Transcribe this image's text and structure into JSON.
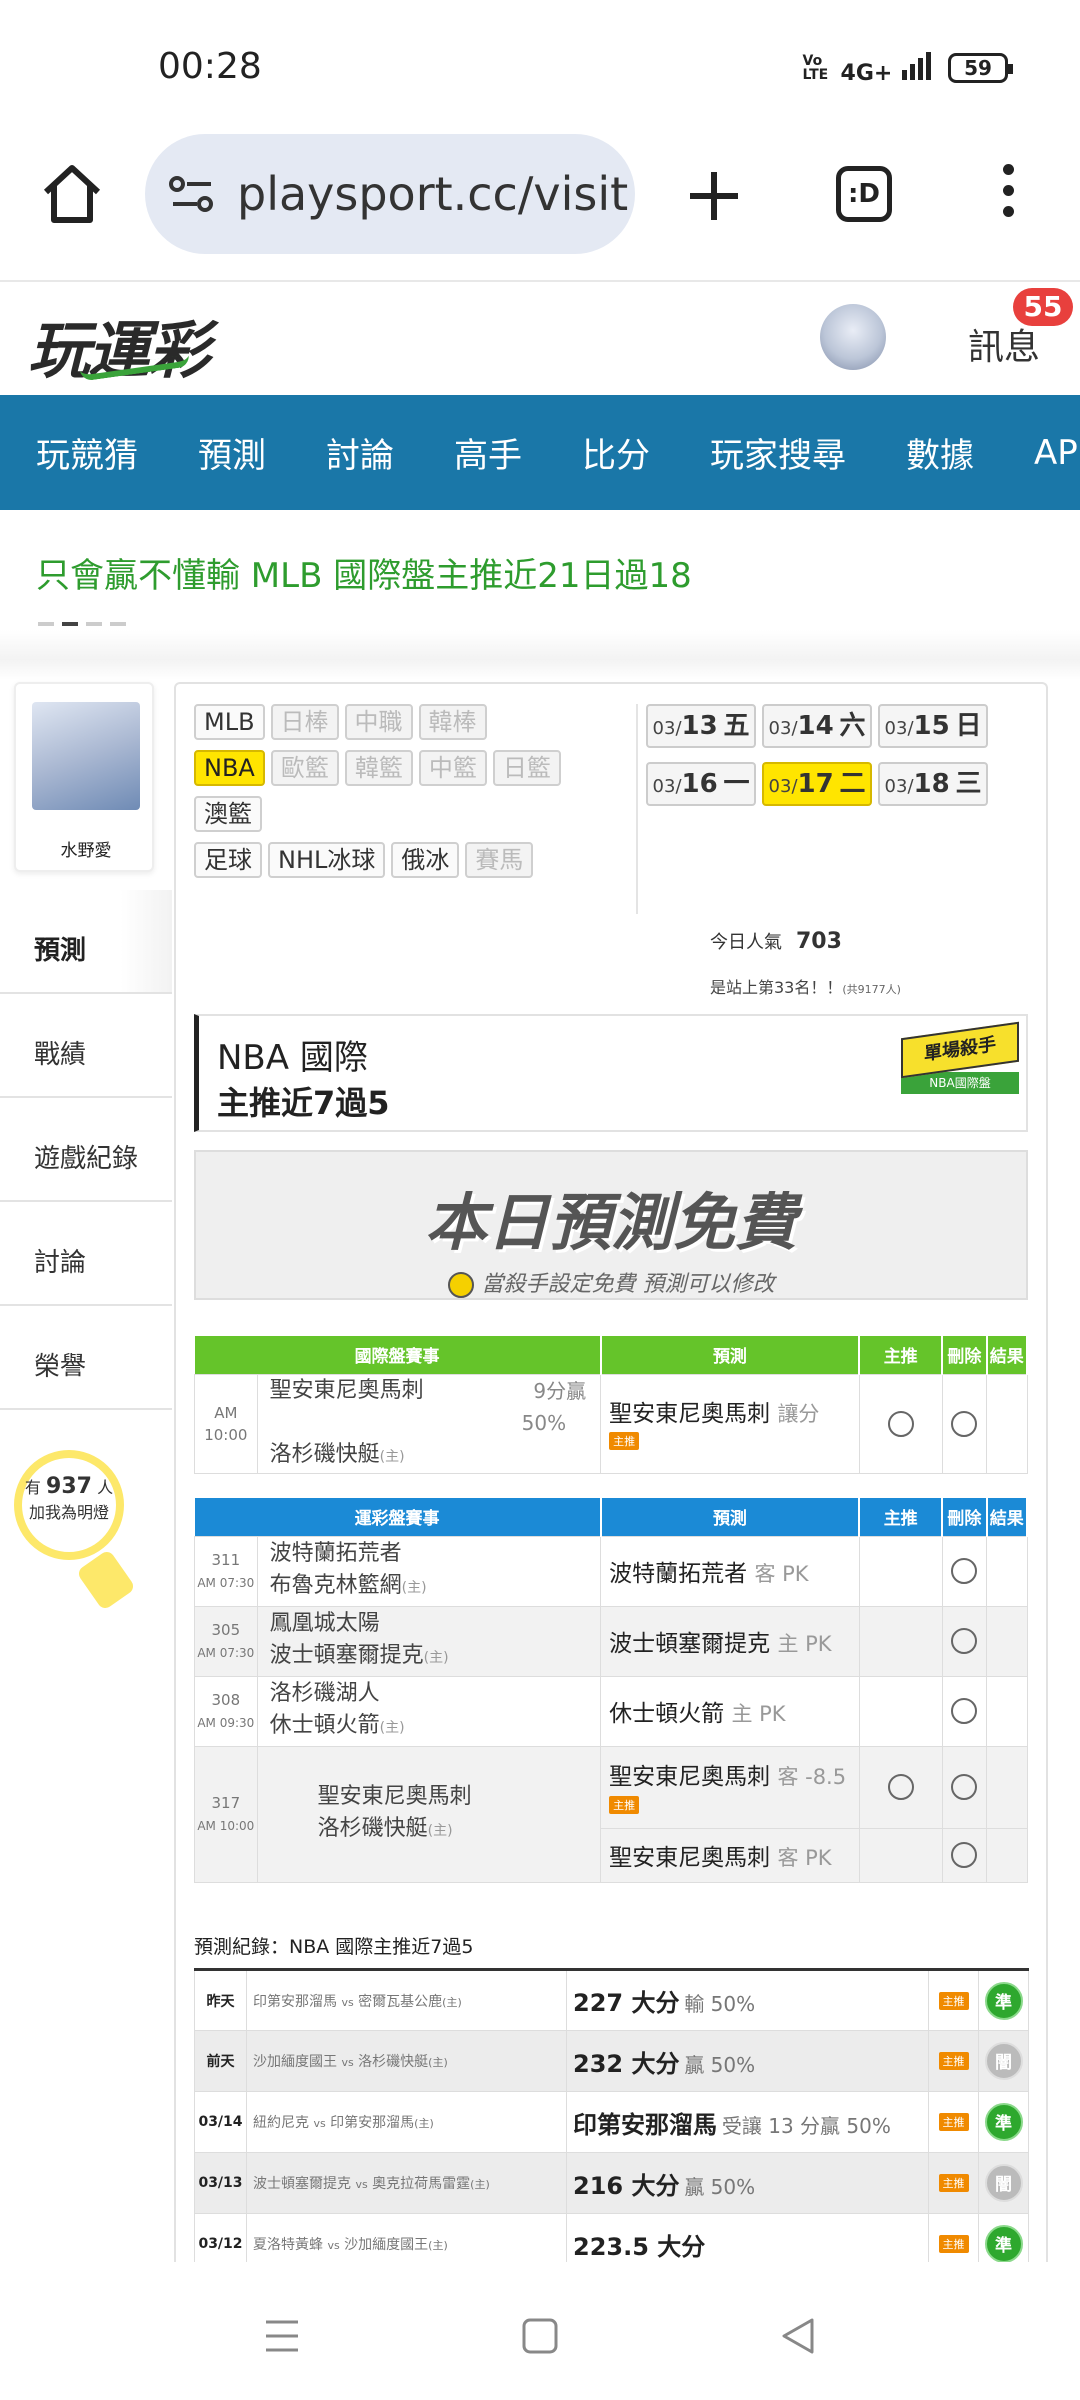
{
  "status": {
    "time": "00:28",
    "network": "4G+",
    "volte": "Vo LTE",
    "battery": "59"
  },
  "browser": {
    "url": "playsport.cc/visit",
    "tabs_label": ":D"
  },
  "header": {
    "logo": "玩運彩",
    "messages_label": "訊息",
    "messages_count": "55"
  },
  "nav": {
    "items": [
      "玩競猜",
      "預測",
      "討論",
      "高手",
      "比分",
      "玩家搜尋",
      "數據",
      "APP"
    ]
  },
  "ticker": {
    "text": "只會贏不懂輸 MLB 國際盤主推近21日過18"
  },
  "profile": {
    "name": "水野愛"
  },
  "side_tabs": [
    "預測",
    "戰績",
    "遊戲紀錄",
    "討論",
    "榮譽"
  ],
  "fans": {
    "prefix": "有",
    "count": "937",
    "suffix": "人",
    "cta": "加我為明燈"
  },
  "sports": {
    "row1": [
      {
        "label": "MLB",
        "state": "normal"
      },
      {
        "label": "日棒",
        "state": "dis"
      },
      {
        "label": "中職",
        "state": "dis"
      },
      {
        "label": "韓棒",
        "state": "dis"
      }
    ],
    "row2": [
      {
        "label": "NBA",
        "state": "sel"
      },
      {
        "label": "歐籃",
        "state": "dis"
      },
      {
        "label": "韓籃",
        "state": "dis"
      },
      {
        "label": "中籃",
        "state": "dis"
      },
      {
        "label": "日籃",
        "state": "dis"
      }
    ],
    "row3": [
      {
        "label": "澳籃",
        "state": "normal"
      }
    ],
    "row4": [
      {
        "label": "足球",
        "state": "normal"
      },
      {
        "label": "NHL冰球",
        "state": "normal"
      },
      {
        "label": "俄冰",
        "state": "normal"
      },
      {
        "label": "賽馬",
        "state": "dis"
      }
    ]
  },
  "dates": [
    {
      "md": "03/",
      "d": "13",
      "w": "五"
    },
    {
      "md": "03/",
      "d": "14",
      "w": "六"
    },
    {
      "md": "03/",
      "d": "15",
      "w": "日"
    },
    {
      "md": "03/",
      "d": "16",
      "w": "一"
    },
    {
      "md": "03/",
      "d": "17",
      "w": "二",
      "selected": true
    },
    {
      "md": "03/",
      "d": "18",
      "w": "三"
    }
  ],
  "popularity": {
    "label": "今日人氣",
    "value": "703",
    "rank_text": "是站上第33名！！",
    "rank_total": "(共9177人)"
  },
  "title_box": {
    "line1": "NBA 國際",
    "line2": "主推近7過5",
    "badge_top": "單場殺手",
    "badge_bottom": "NBA國際盤"
  },
  "free_banner": {
    "title": "本日預測免費",
    "subtitle": "當殺手設定免費 預測可以修改"
  },
  "intl_table": {
    "headers": [
      "國際盤賽事",
      "預測",
      "主推",
      "刪除",
      "結果"
    ],
    "rows": [
      {
        "time": "AM 10:00",
        "team1": "聖安東尼奧馬刺",
        "team2": "洛杉磯快艇",
        "home": "(主)",
        "spread": "9分贏",
        "pct": "50%",
        "pick": "聖安東尼奧馬刺",
        "pick_note": "讓分",
        "tag": "主推"
      }
    ]
  },
  "lottery_table": {
    "headers": [
      "運彩盤賽事",
      "預測",
      "主推",
      "刪除",
      "結果"
    ],
    "rows": [
      {
        "code": "311",
        "time": "AM 07:30",
        "team1": "波特蘭拓荒者",
        "team2": "布魯克林籃網",
        "home": "(主)",
        "pick": "波特蘭拓荒者",
        "pick_note": "客 PK"
      },
      {
        "code": "305",
        "time": "AM 07:30",
        "team1": "鳳凰城太陽",
        "team2": "波士頓塞爾提克",
        "home": "(主)",
        "pick": "波士頓塞爾提克",
        "pick_note": "主 PK"
      },
      {
        "code": "308",
        "time": "AM 09:30",
        "team1": "洛杉磯湖人",
        "team2": "休士頓火箭",
        "home": "(主)",
        "pick": "休士頓火箭",
        "pick_note": "主 PK"
      },
      {
        "code": "317",
        "time": "AM 10:00",
        "team1": "聖安東尼奧馬刺",
        "team2": "洛杉磯快艇",
        "home": "(主)",
        "pick": "聖安東尼奧馬刺",
        "pick_note": "客 -8.5",
        "tag": "主推",
        "pick2": "聖安東尼奧馬刺",
        "pick2_note": "客 PK"
      }
    ]
  },
  "history": {
    "title": "預測紀錄：NBA 國際主推近7過5",
    "rows": [
      {
        "day": "昨天",
        "away": "印第安那溜馬",
        "home": "密爾瓦基公鹿",
        "result": "227 大分",
        "note": "輸 50%",
        "tag": "主推",
        "mark": "準"
      },
      {
        "day": "前天",
        "away": "沙加緬度國王",
        "home": "洛杉磯快艇",
        "result": "232 大分",
        "note": "贏 50%",
        "tag": "主推",
        "mark": "闇"
      },
      {
        "day": "03/14",
        "away": "紐約尼克",
        "home": "印第安那溜馬",
        "result": "印第安那溜馬",
        "note": "受讓 13 分贏 50%",
        "tag": "主推",
        "mark": "準"
      },
      {
        "day": "03/13",
        "away": "波士頓塞爾提克",
        "home": "奧克拉荷馬雷霆",
        "result": "216 大分",
        "note": "贏 50%",
        "tag": "主推",
        "mark": "闇"
      },
      {
        "day": "03/12",
        "away": "夏洛特黃蜂",
        "home": "沙加緬度國王",
        "result": "223.5 大分",
        "note": "",
        "tag": "主推",
        "mark": "準"
      }
    ],
    "vs": "vs",
    "home_tag": "(主)"
  }
}
